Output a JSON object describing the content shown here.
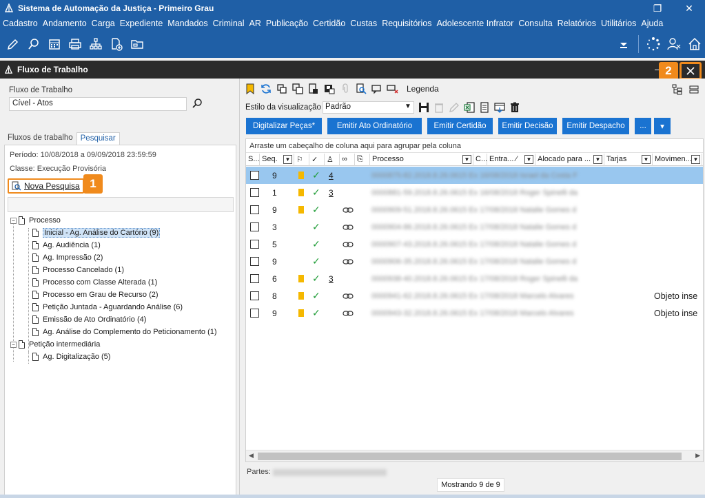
{
  "window": {
    "title": "Sistema de Automação da Justiça - Primeiro Grau",
    "restore_symbol": "❐",
    "close_symbol": "✕"
  },
  "menu": [
    "Cadastro",
    "Andamento",
    "Carga",
    "Expediente",
    "Mandados",
    "Criminal",
    "AR",
    "Publicação",
    "Certidão",
    "Custas",
    "Requisitórios",
    "Adolescente Infrator",
    "Consulta",
    "Relatórios",
    "Utilitários",
    "Ajuda"
  ],
  "toolbar_icons": [
    "edit-icon",
    "search-process-icon",
    "calendar-icon",
    "printer-icon",
    "org-chart-icon",
    "add-document-icon",
    "folder-icon"
  ],
  "panel": {
    "title": "Fluxo de Trabalho",
    "minimize_symbol": "–",
    "close_symbol": "✕",
    "badge_close": "2"
  },
  "left": {
    "workflow_label": "Fluxo de Trabalho",
    "workflow_value": "Cível - Atos",
    "tabs": [
      {
        "label": "Fluxos de trabalho",
        "active": false
      },
      {
        "label": "Pesquisar",
        "active": true
      }
    ],
    "periodo": "Período: 10/08/2018 a 09/09/2018 23:59:59",
    "classe": "Classe: Execução Provisória",
    "nova_pesquisa": "Nova Pesquisa",
    "badge_nova": "1",
    "tree": [
      {
        "label": "Processo",
        "level": 0,
        "expander": "−"
      },
      {
        "label": "Inicial - Ag. Análise do Cartório (9)",
        "level": 1,
        "selected": true
      },
      {
        "label": "Ag. Audiência (1)",
        "level": 1
      },
      {
        "label": "Ag. Impressão (2)",
        "level": 1
      },
      {
        "label": "Processo Cancelado (1)",
        "level": 1
      },
      {
        "label": "Processo com Classe Alterada (1)",
        "level": 1
      },
      {
        "label": "Processo em Grau de Recurso (2)",
        "level": 1
      },
      {
        "label": "Petição Juntada - Aguardando Análise (6)",
        "level": 1
      },
      {
        "label": "Emissão de Ato Ordinatório (4)",
        "level": 1
      },
      {
        "label": "Ag. Análise do Complemento do Peticionamento (1)",
        "level": 1
      },
      {
        "label": "Petição intermediária",
        "level": 0,
        "expander": "−"
      },
      {
        "label": "Ag. Digitalização (5)",
        "level": 1
      }
    ]
  },
  "right": {
    "legend": "Legenda",
    "style_label": "Estilo da visualização",
    "style_value": "Padrão",
    "buttons": [
      {
        "label": "Digitalizar Peças*",
        "w": 110
      },
      {
        "label": "Emitir Ato Ordinatório",
        "w": 137
      },
      {
        "label": "Emitir Certidão",
        "w": 95
      },
      {
        "label": "Emitir Decisão",
        "w": 85
      },
      {
        "label": "Emitir Despacho",
        "w": 97
      },
      {
        "label": "...",
        "w": 24
      },
      {
        "label": "▾",
        "w": 24
      }
    ],
    "group_hint": "Arraste um cabeçalho de coluna aqui para agrupar pela coluna",
    "columns": [
      {
        "label": "S...",
        "w": 20,
        "filter": false
      },
      {
        "label": "Seq.",
        "w": 50,
        "filter": true
      },
      {
        "label": "",
        "w": 22,
        "filter": false
      },
      {
        "label": "",
        "w": 22,
        "filter": false
      },
      {
        "label": "",
        "w": 22,
        "filter": false
      },
      {
        "label": "",
        "w": 22,
        "filter": false
      },
      {
        "label": "",
        "w": 22,
        "filter": false
      },
      {
        "label": "Processo",
        "w": 150,
        "filter": true
      },
      {
        "label": "C...",
        "w": 20,
        "filter": false
      },
      {
        "label": "Entra... ⁄",
        "w": 70,
        "filter": true
      },
      {
        "label": "Alocado para ...",
        "w": 100,
        "filter": true
      },
      {
        "label": "Tarjas",
        "w": 70,
        "filter": true
      },
      {
        "label": "Movimen...",
        "w": 72,
        "filter": true
      }
    ],
    "rows": [
      {
        "seq": "9",
        "flag": true,
        "check": true,
        "num": "4",
        "link": false,
        "proc": "0000875-82.2018.8.26.0615 Ex 16/08/2018 Israel da Costa F",
        "mov": "",
        "selected": true
      },
      {
        "seq": "1",
        "flag": true,
        "check": true,
        "num": "3",
        "link": false,
        "proc": "0000881-59.2018.8.26.0615 Ex 16/08/2018 Roger Spinelli da",
        "mov": ""
      },
      {
        "seq": "9",
        "flag": true,
        "check": true,
        "num": "",
        "link": true,
        "proc": "0000909-51.2018.8.26.0615 Ex 17/08/2018 Natalie Gomes d",
        "mov": ""
      },
      {
        "seq": "3",
        "flag": false,
        "check": true,
        "num": "",
        "link": true,
        "proc": "0000904-86.2018.8.26.0615 Ex 17/08/2018 Natalie Gomes d",
        "mov": ""
      },
      {
        "seq": "5",
        "flag": false,
        "check": true,
        "num": "",
        "link": true,
        "proc": "0000907-43.2018.8.26.0615 Ex 17/08/2018 Natalie Gomes d",
        "mov": ""
      },
      {
        "seq": "9",
        "flag": false,
        "check": true,
        "num": "",
        "link": true,
        "proc": "0000906-35.2018.8.26.0615 Ex 17/08/2018 Natalie Gomes d",
        "mov": ""
      },
      {
        "seq": "6",
        "flag": true,
        "check": true,
        "num": "3",
        "link": false,
        "proc": "0000938-40.2018.8.26.0615 Ex 17/08/2018 Roger Spinelli da",
        "mov": ""
      },
      {
        "seq": "8",
        "flag": true,
        "check": true,
        "num": "",
        "link": true,
        "proc": "0000941-62.2018.8.26.0615 Ex 17/08/2018 Marcelo Alvares",
        "mov": "Objeto inse"
      },
      {
        "seq": "9",
        "flag": true,
        "check": true,
        "num": "",
        "link": true,
        "proc": "0000943-32.2018.8.26.0615 Ex 17/08/2018 Marcelo Alvares",
        "mov": "Objeto inse"
      }
    ],
    "partes_label": "Partes:",
    "mostrando": "Mostrando 9 de 9"
  },
  "colors": {
    "brand_blue": "#1f5fa6",
    "button_blue": "#1a73d1",
    "highlight_orange": "#f08a1c",
    "flag_yellow": "#f5b800",
    "check_green": "#1c9b34",
    "row_selected": "#99c7ef"
  }
}
